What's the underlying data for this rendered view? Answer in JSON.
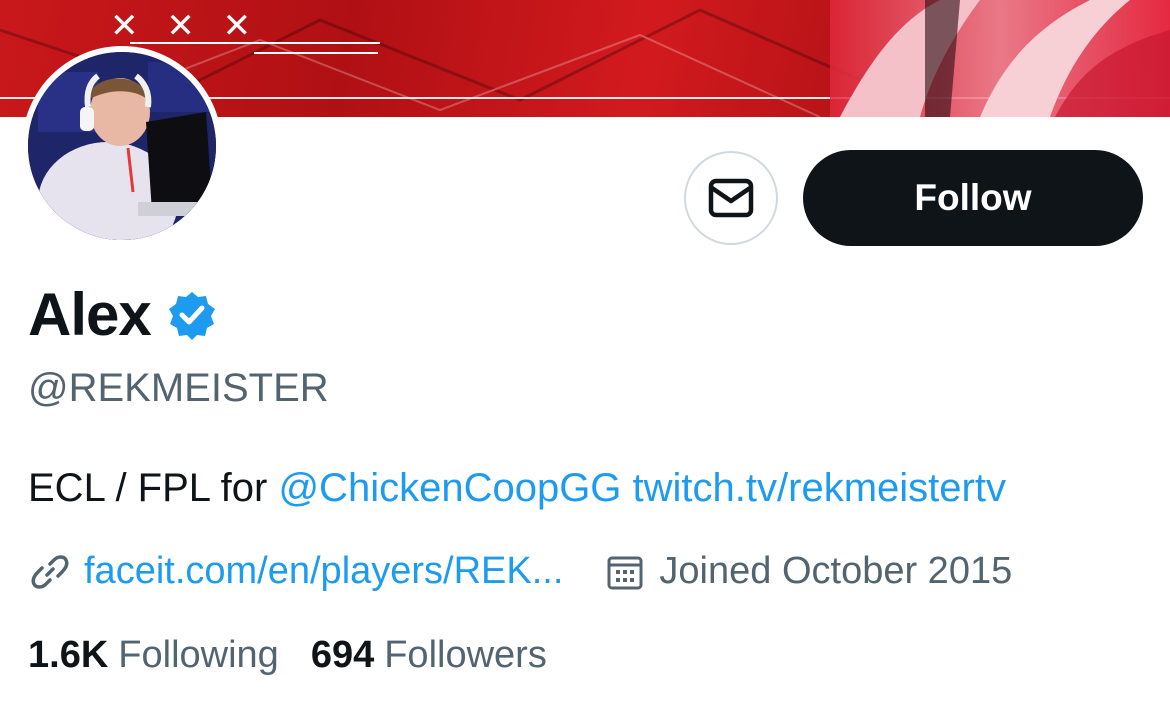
{
  "banner": {
    "marks": "✕ ✕ ✕"
  },
  "profile": {
    "display_name": "Alex",
    "handle": "@REKMEISTER",
    "verified": true
  },
  "actions": {
    "message_icon": "envelope-icon",
    "follow_label": "Follow"
  },
  "bio": {
    "text_before": "ECL / FPL for ",
    "mention": "@ChickenCoopGG",
    "space": " ",
    "url": "twitch.tv/rekmeistertv"
  },
  "meta": {
    "link_icon": "link-icon",
    "website": "faceit.com/en/players/REK...",
    "calendar_icon": "calendar-icon",
    "joined": "Joined October 2015"
  },
  "stats": {
    "following_count": "1.6K",
    "following_label": "Following",
    "followers_count": "694",
    "followers_label": "Followers"
  },
  "colors": {
    "accent": "#1d9bf0",
    "text_primary": "#0f1419",
    "text_secondary": "#536471",
    "banner_red": "#c9181b"
  }
}
